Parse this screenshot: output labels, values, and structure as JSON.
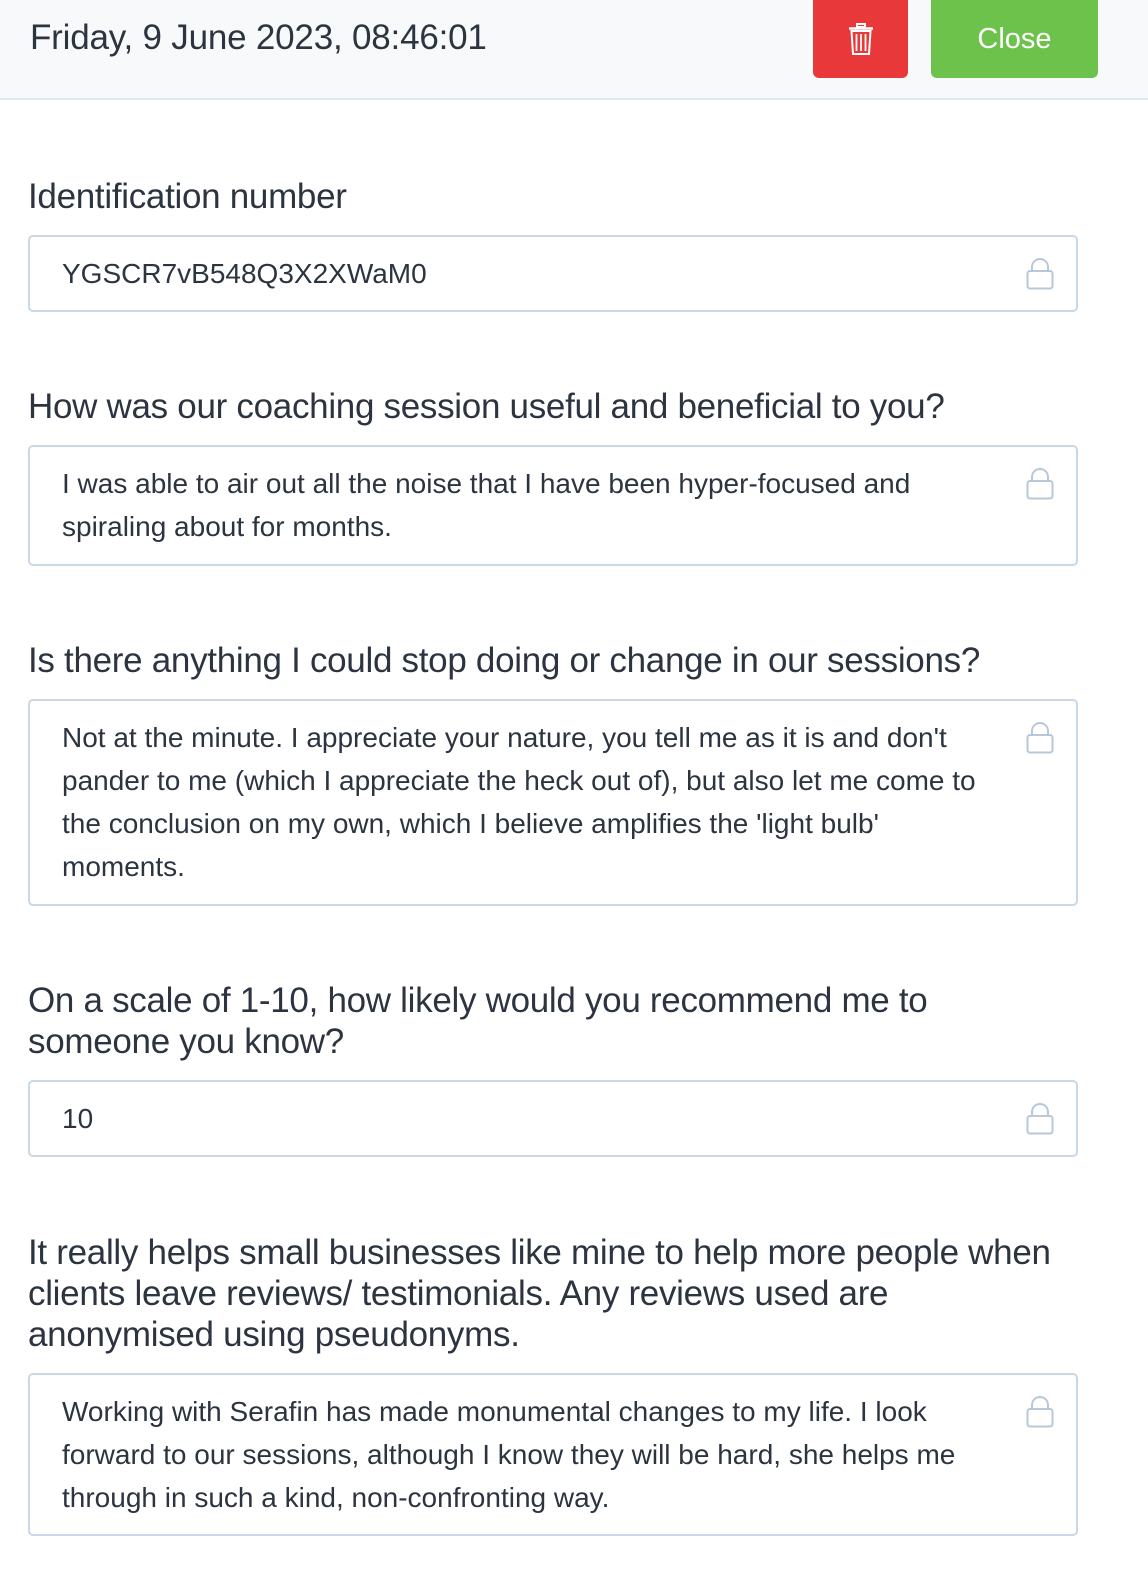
{
  "header": {
    "datetime": "Friday, 9 June 2023, 08:46:01",
    "delete_icon": "trash-icon",
    "close_label": "Close"
  },
  "colors": {
    "delete": "#e9383a",
    "close": "#6cc24a",
    "field_border": "#c9d8e6",
    "lock": "#b7c8d8"
  },
  "fields": [
    {
      "label": "Identification number",
      "value": "YGSCR7vB548Q3X2XWaM0",
      "icon": "lock-icon"
    },
    {
      "label": "How was our coaching session useful and beneficial to you?",
      "value": "I was able to air out all the noise that I have been hyper-focused and spiraling about for months.",
      "icon": "lock-icon"
    },
    {
      "label": "Is there anything I could stop doing or change in our sessions?",
      "value": "Not at the minute. I appreciate your nature, you tell me as it is and don't pander to me (which I appreciate the heck out of), but also let me come to the conclusion on my own, which I believe amplifies the 'light bulb' moments.",
      "icon": "lock-icon"
    },
    {
      "label": "On a scale of 1-10, how likely would you recommend me to someone you know?",
      "value": "10",
      "icon": "lock-icon"
    },
    {
      "label": "It really helps small businesses like mine to help more people when clients leave reviews/ testimonials. Any reviews used are anonymised using pseudonyms.",
      "value": "Working with Serafin has made monumental changes to my life. I look forward to our sessions, although I know they will be hard, she helps me through in such a kind, non-confronting way.",
      "icon": "lock-icon"
    }
  ]
}
